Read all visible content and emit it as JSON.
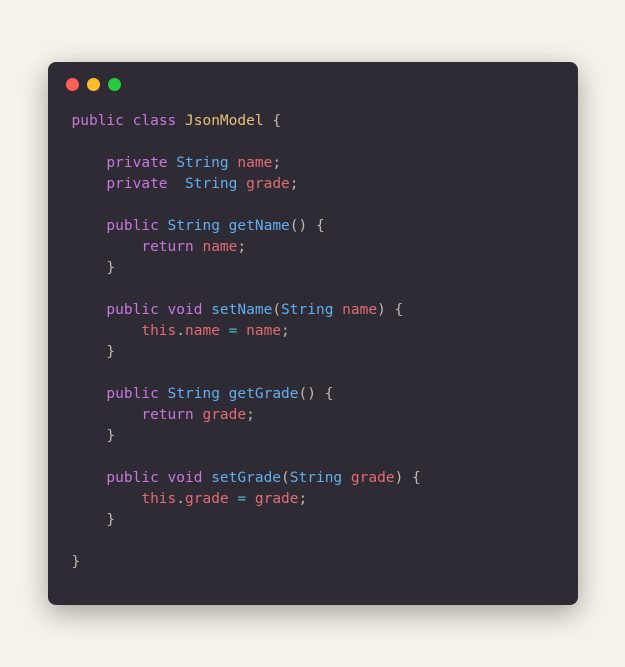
{
  "code": {
    "l1_public": "public",
    "l1_class": "class",
    "l1_classname": "JsonModel",
    "l1_brace": " {",
    "l3_private": "private",
    "l3_type": "String",
    "l3_name": "name",
    "l4_private": "private",
    "l4_type": "String",
    "l4_name": "grade",
    "l6_public": "public",
    "l6_type": "String",
    "l6_method": "getName",
    "l6_paren": "() {",
    "l7_return": "return",
    "l7_var": "name",
    "l8_brace": "}",
    "l10_public": "public",
    "l10_void": "void",
    "l10_method": "setName",
    "l10_paramtype": "String",
    "l10_param": "name",
    "l11_this": "this",
    "l11_dot": ".",
    "l11_field": "name",
    "l11_eq": " = ",
    "l11_var": "name",
    "l12_brace": "}",
    "l14_public": "public",
    "l14_type": "String",
    "l14_method": "getGrade",
    "l14_paren": "() {",
    "l15_return": "return",
    "l15_var": "grade",
    "l16_brace": "}",
    "l18_public": "public",
    "l18_void": "void",
    "l18_method": "setGrade",
    "l18_paramtype": "String",
    "l18_param": "grade",
    "l19_this": "this",
    "l19_dot": ".",
    "l19_field": "grade",
    "l19_eq": " = ",
    "l19_var": "grade",
    "l20_brace": "}",
    "l22_brace": "}",
    "semi": ";",
    "lparen": "(",
    "rparen": ") {"
  }
}
